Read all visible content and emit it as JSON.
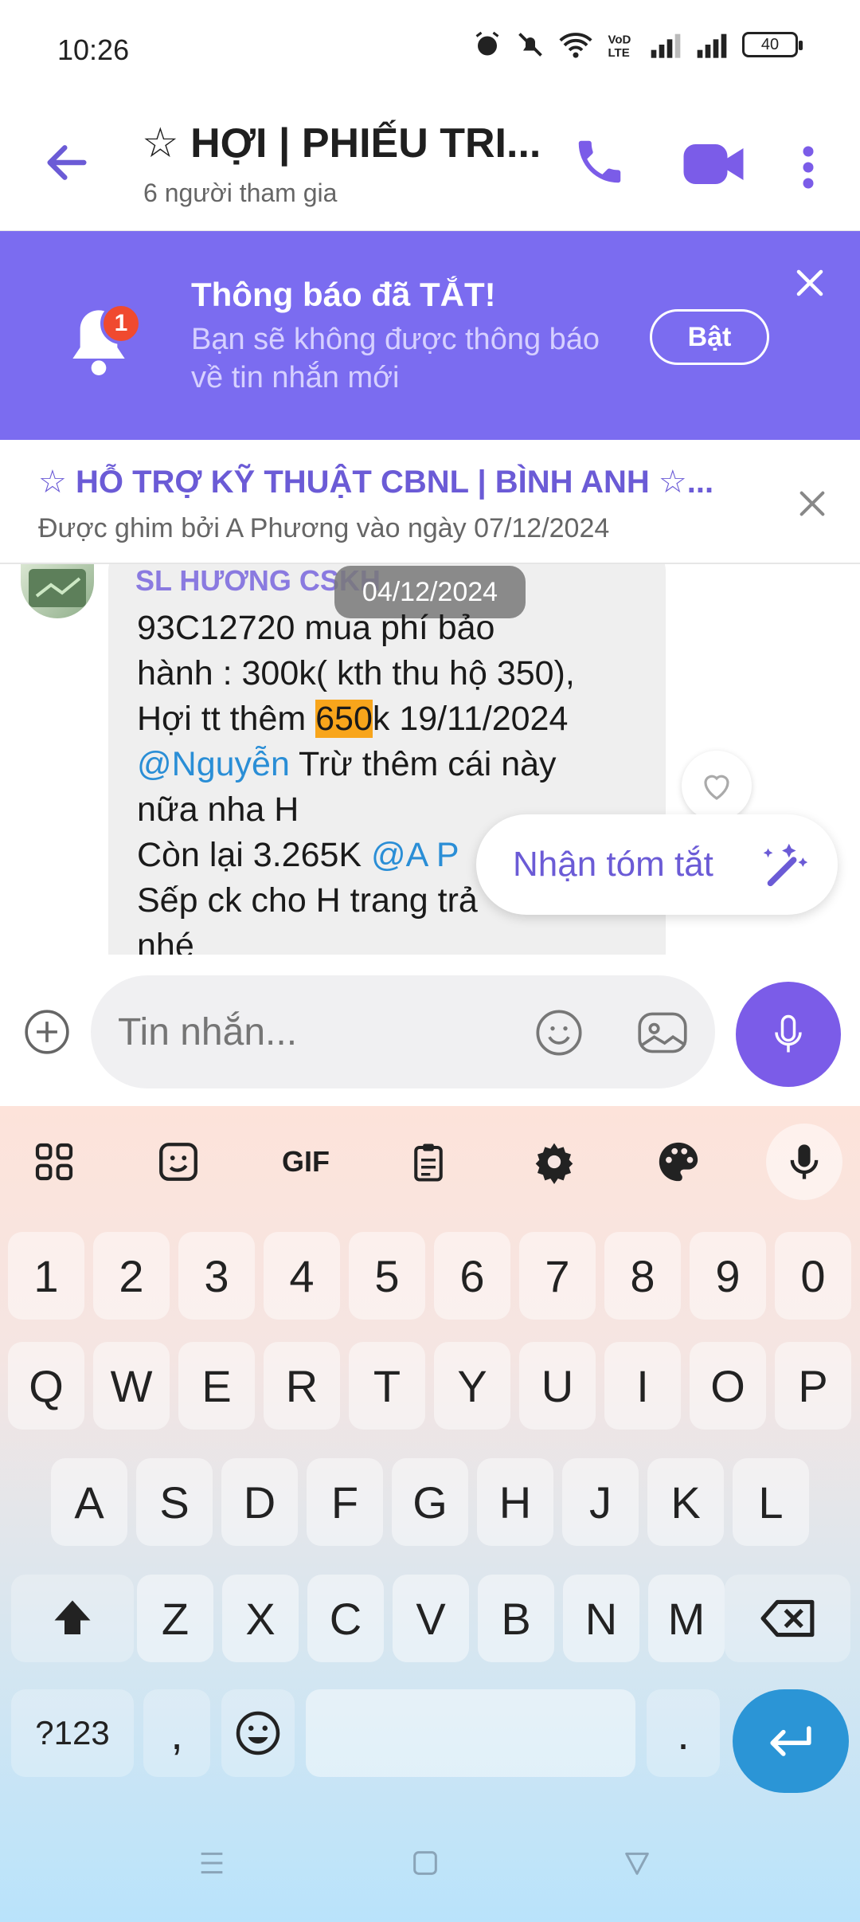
{
  "status_bar": {
    "time": "10:26",
    "battery": "40"
  },
  "header": {
    "title": "☆ HỢI | PHIẾU TRI...",
    "subtitle": "6 người tham gia"
  },
  "notification": {
    "badge": "1",
    "title": "Thông báo đã TẮT!",
    "text": "Bạn sẽ không được thông báo về tin nhắn mới",
    "button": "Bật"
  },
  "pinned": {
    "title": "☆ HỖ TRỢ KỸ THUẬT CBNL | BÌNH ANH ☆...",
    "subtitle": "Được ghim bởi A Phương vào ngày 07/12/2024"
  },
  "chat": {
    "date_pill": "04/12/2024",
    "sender": "SL HƯƠNG CSKH",
    "message": {
      "line1": "93C12720 mua phí bảo",
      "line2": "hành : 300k( kth thu hộ 350),",
      "line3_pre": "Hợi tt thêm ",
      "line3_hl": "650",
      "line3_post": "k 19/11/2024",
      "mention1": "@Nguyễn",
      "line4_post": " Trừ thêm cái này",
      "line5": "nữa nha H",
      "line6_pre": "Còn lại 3.265K ",
      "mention2": "@A P",
      "line7": "Sếp ck cho H trang trả",
      "line8": "nhé"
    },
    "summary_button": "Nhận tóm tắt"
  },
  "composer": {
    "placeholder": "Tin nhắn..."
  },
  "keyboard": {
    "toolbar_gif": "GIF",
    "row_numbers": [
      "1",
      "2",
      "3",
      "4",
      "5",
      "6",
      "7",
      "8",
      "9",
      "0"
    ],
    "row1": [
      "Q",
      "W",
      "E",
      "R",
      "T",
      "Y",
      "U",
      "I",
      "O",
      "P"
    ],
    "row2": [
      "A",
      "S",
      "D",
      "F",
      "G",
      "H",
      "J",
      "K",
      "L"
    ],
    "row3": [
      "Z",
      "X",
      "C",
      "V",
      "B",
      "N",
      "M"
    ],
    "symbols": "?123",
    "comma": ",",
    "period": "."
  }
}
